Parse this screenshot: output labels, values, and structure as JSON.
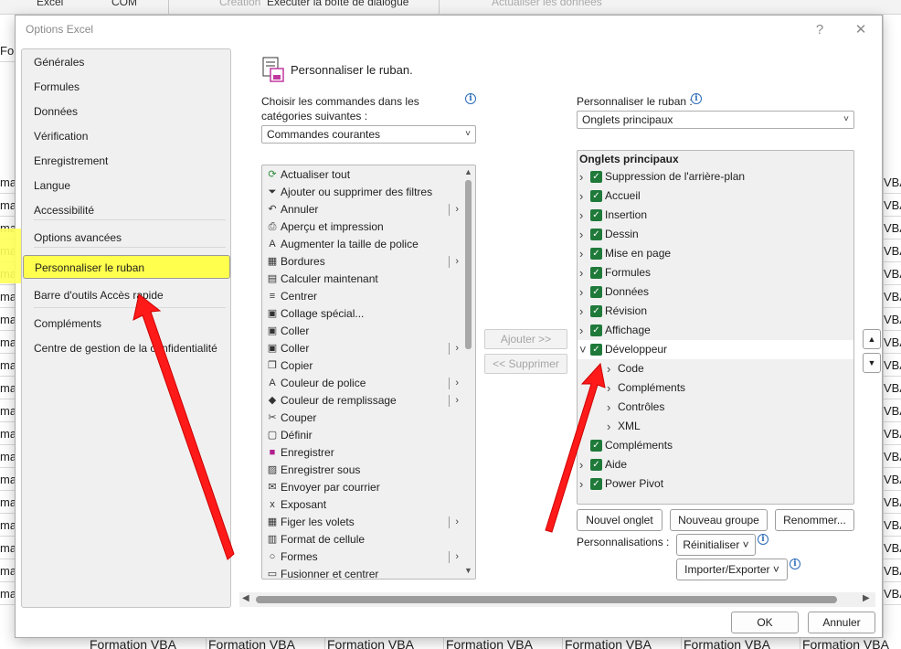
{
  "background": {
    "ribbon_items": [
      "Exécuter la boîte de dialogue",
      "Actualiser les données"
    ],
    "sheet_left_labels": [
      "For",
      "ma",
      "ma",
      "ma",
      "ma",
      "ma",
      "ma",
      "ma",
      "ma",
      "ma",
      "ma",
      "ma",
      "ma",
      "ma",
      "ma",
      "ma",
      "ma",
      "ma",
      "ma",
      "ma"
    ],
    "sheet_right_label": "VBA",
    "sheet_bottom_cell": "Formation VBA"
  },
  "dialog": {
    "title": "Options Excel",
    "help": "?",
    "close": "✕"
  },
  "nav": {
    "items": [
      "Générales",
      "Formules",
      "Données",
      "Vérification",
      "Enregistrement",
      "Langue",
      "Accessibilité",
      "Options avancées",
      "Personnaliser le ruban",
      "Barre d'outils Accès rapide",
      "Compléments",
      "Centre de gestion de la confidentialité"
    ],
    "selected": "Personnaliser le ruban"
  },
  "panel": {
    "title": "Personnaliser le ruban.",
    "choose_label_1": "Choisir les commandes dans les",
    "choose_label_2": "catégories suivantes :",
    "choose_value": "Commandes courantes",
    "customize_label": "Personnaliser le ruban :",
    "customize_value": "Onglets principaux"
  },
  "commands": [
    {
      "icon": "refresh-icon",
      "label": "Actualiser tout",
      "sub": false
    },
    {
      "icon": "filter-icon",
      "label": "Ajouter ou supprimer des filtres",
      "sub": false
    },
    {
      "icon": "undo-icon",
      "label": "Annuler",
      "sub": true
    },
    {
      "icon": "print-preview-icon",
      "label": "Aperçu et impression",
      "sub": false
    },
    {
      "icon": "font-size-up-icon",
      "label": "Augmenter la taille de police",
      "sub": false
    },
    {
      "icon": "borders-icon",
      "label": "Bordures",
      "sub": true
    },
    {
      "icon": "calculator-icon",
      "label": "Calculer maintenant",
      "sub": false
    },
    {
      "icon": "align-center-icon",
      "label": "Centrer",
      "sub": false
    },
    {
      "icon": "paste-special-icon",
      "label": "Collage spécial...",
      "sub": false
    },
    {
      "icon": "paste-icon",
      "label": "Coller",
      "sub": false
    },
    {
      "icon": "paste-icon",
      "label": "Coller",
      "sub": true
    },
    {
      "icon": "copy-icon",
      "label": "Copier",
      "sub": false
    },
    {
      "icon": "font-color-icon",
      "label": "Couleur de police",
      "sub": true
    },
    {
      "icon": "fill-color-icon",
      "label": "Couleur de remplissage",
      "sub": true
    },
    {
      "icon": "cut-icon",
      "label": "Couper",
      "sub": false
    },
    {
      "icon": "define-icon",
      "label": "Définir",
      "sub": false
    },
    {
      "icon": "save-icon",
      "label": "Enregistrer",
      "sub": false
    },
    {
      "icon": "save-as-icon",
      "label": "Enregistrer sous",
      "sub": false
    },
    {
      "icon": "mail-icon",
      "label": "Envoyer par courrier",
      "sub": false
    },
    {
      "icon": "superscript-icon",
      "label": "Exposant",
      "sub": false
    },
    {
      "icon": "freeze-panes-icon",
      "label": "Figer les volets",
      "sub": true
    },
    {
      "icon": "format-cells-icon",
      "label": "Format de cellule",
      "sub": false
    },
    {
      "icon": "shapes-icon",
      "label": "Formes",
      "sub": true
    },
    {
      "icon": "merge-icon",
      "label": "Fusionner et centrer",
      "sub": false
    }
  ],
  "middle_buttons": {
    "add": "Ajouter >>",
    "remove": "<< Supprimer"
  },
  "tree": {
    "header": "Onglets principaux",
    "rows": [
      {
        "label": "Suppression de l'arrière-plan",
        "level": 0,
        "checked": true,
        "expanded": false
      },
      {
        "label": "Accueil",
        "level": 0,
        "checked": true,
        "expanded": false
      },
      {
        "label": "Insertion",
        "level": 0,
        "checked": true,
        "expanded": false
      },
      {
        "label": "Dessin",
        "level": 0,
        "checked": true,
        "expanded": false
      },
      {
        "label": "Mise en page",
        "level": 0,
        "checked": true,
        "expanded": false
      },
      {
        "label": "Formules",
        "level": 0,
        "checked": true,
        "expanded": false
      },
      {
        "label": "Données",
        "level": 0,
        "checked": true,
        "expanded": false
      },
      {
        "label": "Révision",
        "level": 0,
        "checked": true,
        "expanded": false
      },
      {
        "label": "Affichage",
        "level": 0,
        "checked": true,
        "expanded": false
      },
      {
        "label": "Développeur",
        "level": 0,
        "checked": true,
        "expanded": true
      },
      {
        "label": "Code",
        "level": 1,
        "checked": false,
        "expanded": false
      },
      {
        "label": "Compléments",
        "level": 1,
        "checked": false,
        "expanded": false
      },
      {
        "label": "Contrôles",
        "level": 1,
        "checked": false,
        "expanded": false
      },
      {
        "label": "XML",
        "level": 1,
        "checked": false,
        "expanded": false
      },
      {
        "label": "Compléments",
        "level": 0,
        "checked": true,
        "expanded": null
      },
      {
        "label": "Aide",
        "level": 0,
        "checked": true,
        "expanded": false
      },
      {
        "label": "Power Pivot",
        "level": 0,
        "checked": true,
        "expanded": false
      }
    ]
  },
  "bottom_buttons": {
    "new_tab": "Nouvel onglet",
    "new_group": "Nouveau groupe",
    "rename": "Renommer...",
    "personalizations_label": "Personnalisations :",
    "reset": "Réinitialiser ˅",
    "import_export": "Importer/Exporter ˅",
    "ok": "OK",
    "cancel": "Annuler"
  },
  "colors": {
    "highlight": "#ffff33",
    "arrow": "#ff1a1a",
    "checkbox": "#1f7a3a"
  }
}
